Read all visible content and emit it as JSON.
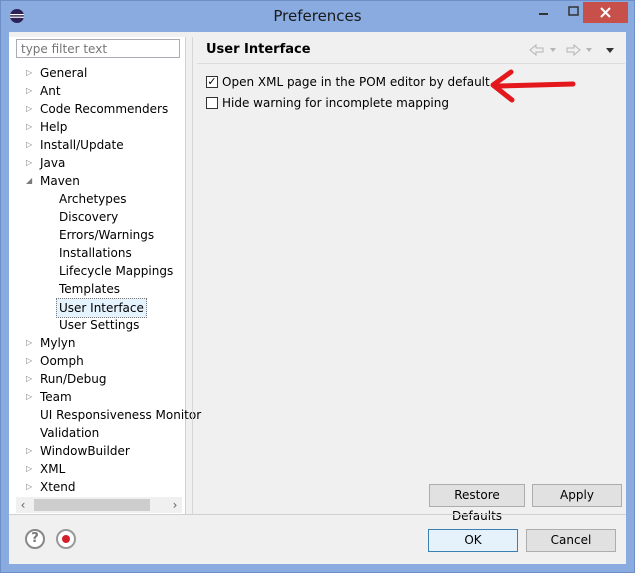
{
  "window": {
    "title": "Preferences"
  },
  "filter": {
    "placeholder": "type filter text"
  },
  "tree": {
    "items": [
      {
        "label": "General",
        "expandable": true
      },
      {
        "label": "Ant",
        "expandable": true
      },
      {
        "label": "Code Recommenders",
        "expandable": true
      },
      {
        "label": "Help",
        "expandable": true
      },
      {
        "label": "Install/Update",
        "expandable": true
      },
      {
        "label": "Java",
        "expandable": true
      },
      {
        "label": "Maven",
        "expanded": true
      },
      {
        "label": "Archetypes",
        "child": true
      },
      {
        "label": "Discovery",
        "child": true
      },
      {
        "label": "Errors/Warnings",
        "child": true
      },
      {
        "label": "Installations",
        "child": true
      },
      {
        "label": "Lifecycle Mappings",
        "child": true
      },
      {
        "label": "Templates",
        "child": true
      },
      {
        "label": "User Interface",
        "child": true,
        "selected": true
      },
      {
        "label": "User Settings",
        "child": true
      },
      {
        "label": "Mylyn",
        "expandable": true
      },
      {
        "label": "Oomph",
        "expandable": true
      },
      {
        "label": "Run/Debug",
        "expandable": true
      },
      {
        "label": "Team",
        "expandable": true
      },
      {
        "label": "UI Responsiveness Monitor"
      },
      {
        "label": "Validation"
      },
      {
        "label": "WindowBuilder",
        "expandable": true
      },
      {
        "label": "XML",
        "expandable": true
      },
      {
        "label": "Xtend",
        "expandable": true
      }
    ]
  },
  "page": {
    "title": "User Interface",
    "options": [
      {
        "label": "Open XML page in the POM editor by default",
        "checked": true
      },
      {
        "label": "Hide warning for incomplete mapping",
        "checked": false
      }
    ]
  },
  "buttons": {
    "restore_defaults": "Restore Defaults",
    "apply": "Apply",
    "ok": "OK",
    "cancel": "Cancel"
  },
  "icons": {
    "back": "back-arrow-icon",
    "forward": "forward-arrow-icon",
    "menu": "view-menu-icon",
    "help": "help-icon",
    "stop": "stop-icon",
    "annotation_arrow": "red-arrow-icon"
  },
  "colors": {
    "annotation_arrow": "#e3171c",
    "stop": "#d3202b"
  }
}
